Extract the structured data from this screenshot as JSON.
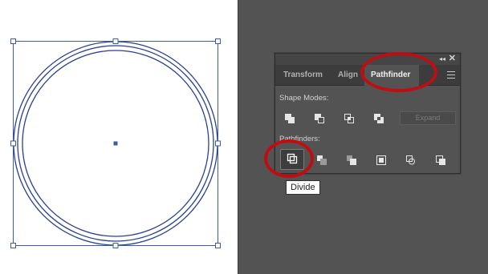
{
  "panel": {
    "tabs": [
      {
        "label": "Transform",
        "active": false
      },
      {
        "label": "Align",
        "active": false
      },
      {
        "label": "Pathfinder",
        "active": true
      }
    ],
    "collapse_glyph": "◂◂",
    "close_glyph": "✕",
    "menu_icon": "hamburger-icon",
    "shape_modes_label": "Shape Modes:",
    "shape_mode_buttons": [
      "unite",
      "minus-front",
      "intersect",
      "exclude"
    ],
    "expand_label": "Expand",
    "pathfinders_label": "Pathfinders:",
    "pathfinder_buttons": [
      "divide",
      "trim",
      "merge",
      "crop",
      "outline",
      "minus-back"
    ],
    "selected_button": "divide"
  },
  "tooltip": {
    "text": "Divide"
  },
  "artboard": {
    "object": "three-concentric-circles",
    "selection_color": "#3b5bab",
    "stroke_color": "#2b3f8f"
  },
  "annotations": {
    "highlight_color": "#c00d12"
  }
}
